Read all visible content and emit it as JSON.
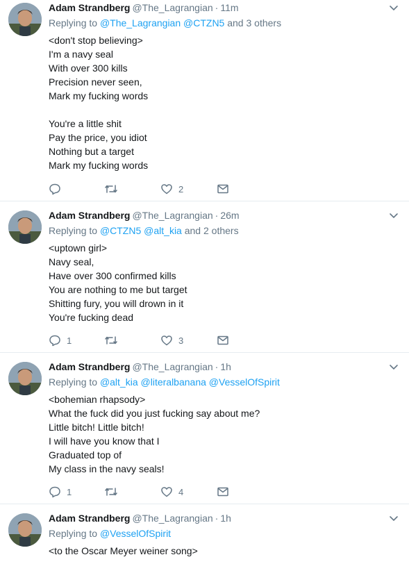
{
  "tweets": [
    {
      "name": "Adam Strandberg",
      "handle": "@The_Lagrangian",
      "sep": "·",
      "time": "11m",
      "replying_prefix": "Replying to",
      "mentions": [
        "@The_Lagrangian",
        "@CTZN5"
      ],
      "replying_suffix": "and 3 others",
      "lines": [
        "<don't stop believing>",
        "I'm a navy seal",
        "With over 300 kills",
        "Precision never seen,",
        "Mark my fucking words",
        "",
        "You're a little shit",
        "Pay the price, you idiot",
        "Nothing but a target",
        "Mark my fucking words"
      ],
      "reply_count": "",
      "retweet_count": "",
      "like_count": "2"
    },
    {
      "name": "Adam Strandberg",
      "handle": "@The_Lagrangian",
      "sep": "·",
      "time": "26m",
      "replying_prefix": "Replying to",
      "mentions": [
        "@CTZN5",
        "@alt_kia"
      ],
      "replying_suffix": "and 2 others",
      "lines": [
        "<uptown girl>",
        "Navy seal,",
        "Have over 300 confirmed kills",
        "You are nothing to me but target",
        "Shitting fury, you will drown in it",
        "You're fucking dead"
      ],
      "reply_count": "1",
      "retweet_count": "",
      "like_count": "3"
    },
    {
      "name": "Adam Strandberg",
      "handle": "@The_Lagrangian",
      "sep": "·",
      "time": "1h",
      "replying_prefix": "Replying to",
      "mentions": [
        "@alt_kia",
        "@literalbanana",
        "@VesselOfSpirit"
      ],
      "replying_suffix": "",
      "lines": [
        "<bohemian rhapsody>",
        "What the fuck did you just fucking say about me?",
        "Little bitch! Little bitch!",
        "I will have you know that I",
        "Graduated top of",
        "My class in the navy seals!"
      ],
      "reply_count": "1",
      "retweet_count": "",
      "like_count": "4"
    },
    {
      "name": "Adam Strandberg",
      "handle": "@The_Lagrangian",
      "sep": "·",
      "time": "1h",
      "replying_prefix": "Replying to",
      "mentions": [
        "@VesselOfSpirit"
      ],
      "replying_suffix": "",
      "lines": [
        "<to the Oscar Meyer weiner song>"
      ],
      "reply_count": "",
      "retweet_count": "",
      "like_count": ""
    }
  ],
  "icons": {
    "reply": "reply-icon",
    "retweet": "retweet-icon",
    "like": "heart-icon",
    "dm": "envelope-icon",
    "caret": "chevron-down-icon"
  },
  "colors": {
    "link": "#1da1f2",
    "muted": "#657786",
    "text": "#14171a",
    "divider": "#e6ecf0"
  }
}
